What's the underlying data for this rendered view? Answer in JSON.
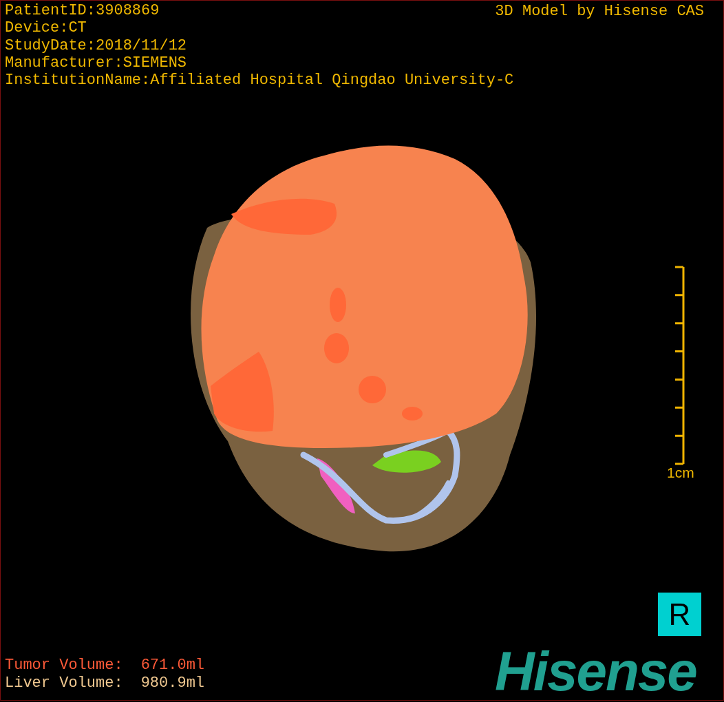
{
  "info_lines": [
    "PatientID:3908869",
    "Device:CT",
    "StudyDate:2018/11/12",
    "Manufacturer:SIEMENS",
    "InstitutionName:Affiliated Hospital Qingdao University-C"
  ],
  "model_credit": "3D Model by Hisense CAS",
  "scale_bar": {
    "label": "1cm"
  },
  "orientation_marker": "R",
  "volumes": [
    {
      "kind": "tumor",
      "label": "Tumor Volume:",
      "value": "671.0ml"
    },
    {
      "kind": "liver",
      "label": "Liver Volume:",
      "value": "980.9ml"
    }
  ],
  "logo": "Hisense"
}
